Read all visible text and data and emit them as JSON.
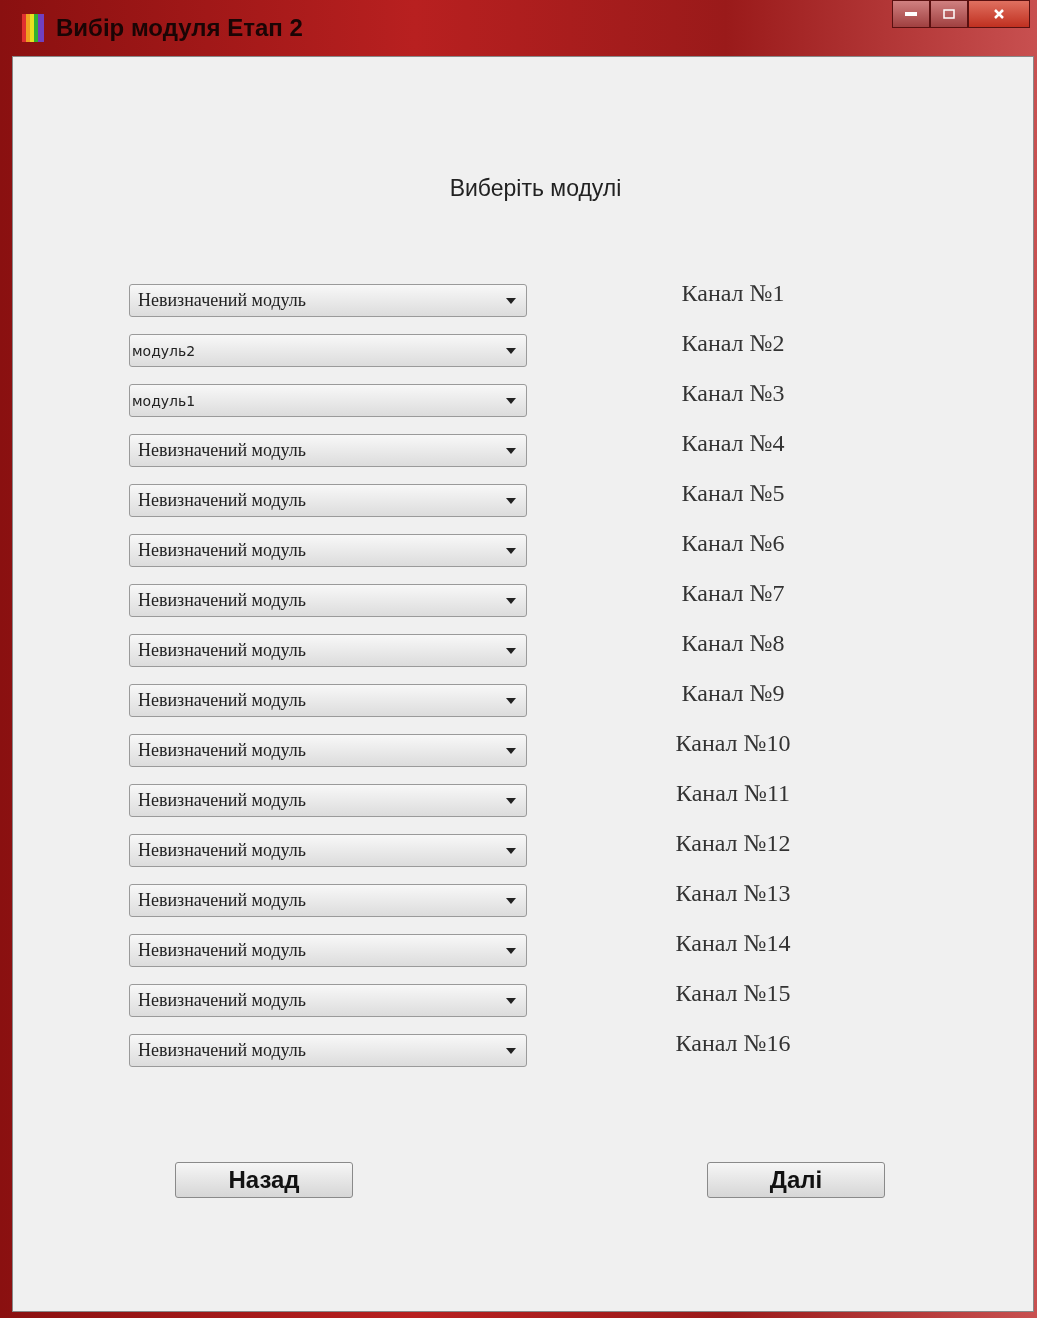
{
  "window": {
    "title": "Вибір модуля Етап 2"
  },
  "heading": "Виберіть модулі",
  "channels": [
    {
      "value": "Невизначений модуль",
      "kind": "default",
      "label": "Канал №1"
    },
    {
      "value": "модуль2",
      "kind": "module",
      "label": "Канал №2"
    },
    {
      "value": "модуль1",
      "kind": "module",
      "label": "Канал №3"
    },
    {
      "value": "Невизначений модуль",
      "kind": "default",
      "label": "Канал №4"
    },
    {
      "value": "Невизначений модуль",
      "kind": "default",
      "label": "Канал №5"
    },
    {
      "value": "Невизначений модуль",
      "kind": "default",
      "label": "Канал №6"
    },
    {
      "value": "Невизначений модуль",
      "kind": "default",
      "label": "Канал №7"
    },
    {
      "value": "Невизначений модуль",
      "kind": "default",
      "label": "Канал №8"
    },
    {
      "value": "Невизначений модуль",
      "kind": "default",
      "label": "Канал №9"
    },
    {
      "value": "Невизначений модуль",
      "kind": "default",
      "label": "Канал №10"
    },
    {
      "value": "Невизначений модуль",
      "kind": "default",
      "label": "Канал №11"
    },
    {
      "value": "Невизначений модуль",
      "kind": "default",
      "label": "Канал №12"
    },
    {
      "value": "Невизначений модуль",
      "kind": "default",
      "label": "Канал №13"
    },
    {
      "value": "Невизначений модуль",
      "kind": "default",
      "label": "Канал №14"
    },
    {
      "value": "Невизначений модуль",
      "kind": "default",
      "label": "Канал №15"
    },
    {
      "value": "Невизначений модуль",
      "kind": "default",
      "label": "Канал №16"
    }
  ],
  "buttons": [
    "Назад",
    "Далі"
  ]
}
